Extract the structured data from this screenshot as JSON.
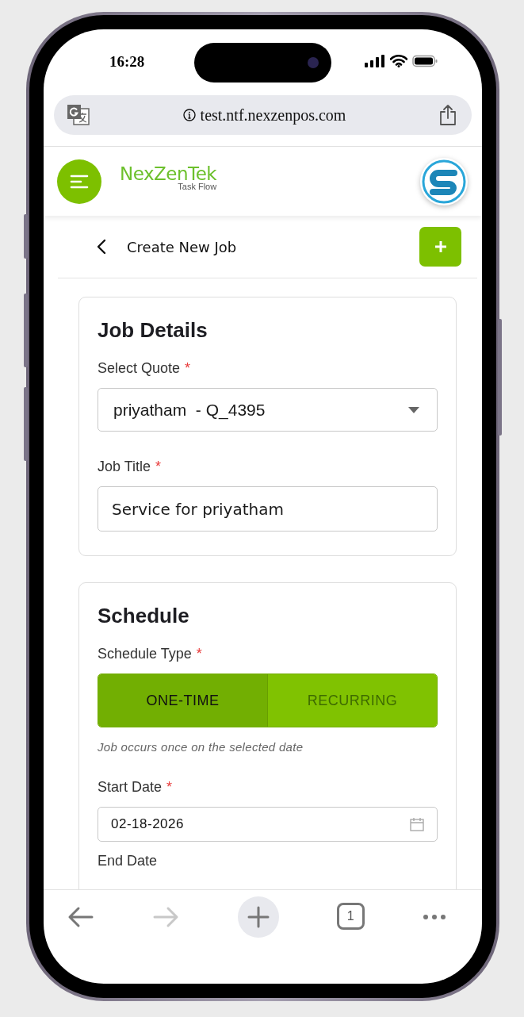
{
  "status_bar": {
    "time": "16:28"
  },
  "browser": {
    "url": "test.ntf.nexzenpos.com"
  },
  "header": {
    "logo_name": "NexZenTek",
    "logo_tagline": "Task Flow"
  },
  "page": {
    "title": "Create New Job"
  },
  "job_details": {
    "title": "Job Details",
    "select_quote": {
      "label": "Select Quote",
      "required_mark": "*",
      "value": "priyatham  - Q_4395"
    },
    "job_title": {
      "label": "Job Title",
      "required_mark": "*",
      "value": "Service for priyatham"
    }
  },
  "schedule": {
    "title": "Schedule",
    "schedule_type": {
      "label": "Schedule Type",
      "required_mark": "*",
      "options": [
        {
          "label": "ONE-TIME",
          "selected": true
        },
        {
          "label": "RECURRING",
          "selected": false
        }
      ]
    },
    "hint": "Job occurs once on the selected date",
    "start_date": {
      "label": "Start Date",
      "required_mark": "*",
      "value": "02-18-2026"
    },
    "end_date": {
      "label": "End Date"
    }
  },
  "toolbar": [
    {
      "kind": "back",
      "disabled": false
    },
    {
      "kind": "forward",
      "disabled": true
    },
    {
      "kind": "new-tab",
      "disabled": false
    },
    {
      "kind": "tabs",
      "count": "1",
      "disabled": false
    },
    {
      "kind": "more",
      "disabled": false
    }
  ]
}
